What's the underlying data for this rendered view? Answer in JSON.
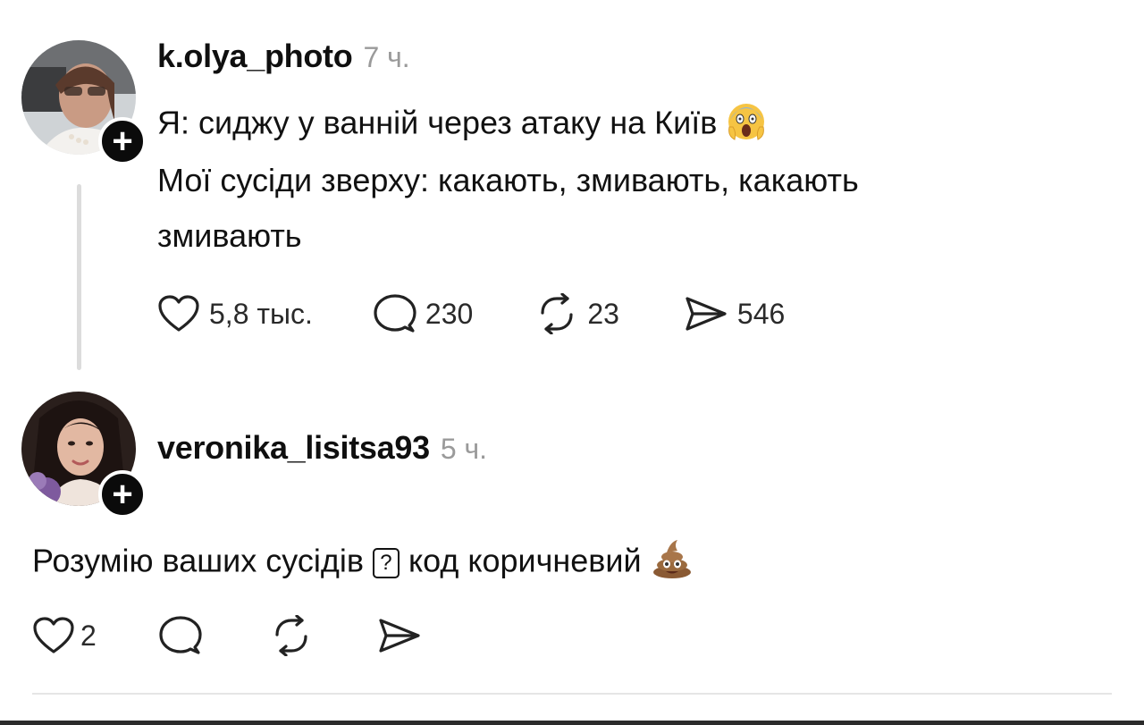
{
  "post1": {
    "username": "k.olya_photo",
    "time": "7 ч.",
    "line1": "Я: сиджу у ванній через атаку на Київ",
    "line2": "Мої сусіди зверху: какають, змивають, какають",
    "line3": "змивають",
    "likes": "5,8 тыс.",
    "replies": "230",
    "reposts": "23",
    "shares": "546"
  },
  "post2": {
    "username": "veronika_lisitsa93",
    "time": "5 ч.",
    "text_part1": "Розумію ваших сусідів",
    "qbox": "?",
    "text_part2": "код коричневий",
    "likes": "2"
  },
  "colors": {
    "text": "#111111",
    "muted": "#9a9a9a",
    "thread_line": "#dcdcdc",
    "badge": "#0b0b0b"
  },
  "icons": {
    "like": "heart-icon",
    "reply": "comment-bubble-icon",
    "repost": "repost-icon",
    "share": "send-icon",
    "follow": "plus-icon",
    "emoji1": "screaming-face-emoji",
    "emoji2": "pile-of-poo-emoji"
  }
}
